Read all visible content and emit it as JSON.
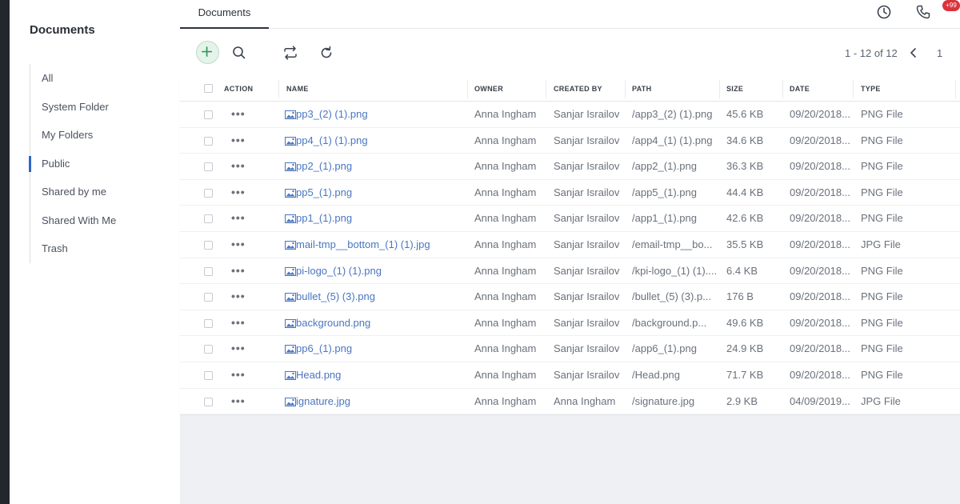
{
  "sidebar": {
    "title": "Documents",
    "items": [
      {
        "label": "All"
      },
      {
        "label": "System Folder"
      },
      {
        "label": "My Folders"
      },
      {
        "label": "Public",
        "active": true
      },
      {
        "label": "Shared by me"
      },
      {
        "label": "Shared With Me"
      },
      {
        "label": "Trash"
      }
    ]
  },
  "header": {
    "tab": "Documents",
    "badge": "+99",
    "icons": [
      "clock-icon",
      "phone-icon"
    ]
  },
  "toolbar": {
    "icons": [
      "plus-icon",
      "search-icon",
      "transfer-icon",
      "refresh-icon"
    ],
    "pagination": {
      "range": "1 - 12 of 12",
      "page": "1"
    }
  },
  "table": {
    "columns": [
      "ACTION",
      "NAME",
      "OWNER",
      "CREATED BY",
      "PATH",
      "SIZE",
      "DATE",
      "TYPE"
    ],
    "rows": [
      {
        "name": "pp3_(2) (1).png",
        "owner": "Anna Ingham",
        "created_by": "Sanjar Israilov",
        "path": "/app3_(2) (1).png",
        "size": "45.6 KB",
        "date": "09/20/2018...",
        "type": "PNG File"
      },
      {
        "name": "pp4_(1) (1).png",
        "owner": "Anna Ingham",
        "created_by": "Sanjar Israilov",
        "path": "/app4_(1) (1).png",
        "size": "34.6 KB",
        "date": "09/20/2018...",
        "type": "PNG File"
      },
      {
        "name": "pp2_(1).png",
        "owner": "Anna Ingham",
        "created_by": "Sanjar Israilov",
        "path": "/app2_(1).png",
        "size": "36.3 KB",
        "date": "09/20/2018...",
        "type": "PNG File"
      },
      {
        "name": "pp5_(1).png",
        "owner": "Anna Ingham",
        "created_by": "Sanjar Israilov",
        "path": "/app5_(1).png",
        "size": "44.4 KB",
        "date": "09/20/2018...",
        "type": "PNG File"
      },
      {
        "name": "pp1_(1).png",
        "owner": "Anna Ingham",
        "created_by": "Sanjar Israilov",
        "path": "/app1_(1).png",
        "size": "42.6 KB",
        "date": "09/20/2018...",
        "type": "PNG File"
      },
      {
        "name": "mail-tmp__bottom_(1) (1).jpg",
        "owner": "Anna Ingham",
        "created_by": "Sanjar Israilov",
        "path": "/email-tmp__bo...",
        "size": "35.5 KB",
        "date": "09/20/2018...",
        "type": "JPG File"
      },
      {
        "name": "pi-logo_(1) (1).png",
        "owner": "Anna Ingham",
        "created_by": "Sanjar Israilov",
        "path": "/kpi-logo_(1) (1)....",
        "size": "6.4 KB",
        "date": "09/20/2018...",
        "type": "PNG File"
      },
      {
        "name": "bullet_(5) (3).png",
        "owner": "Anna Ingham",
        "created_by": "Sanjar Israilov",
        "path": "/bullet_(5) (3).p...",
        "size": "176 B",
        "date": "09/20/2018...",
        "type": "PNG File"
      },
      {
        "name": "background.png",
        "owner": "Anna Ingham",
        "created_by": "Sanjar Israilov",
        "path": "/background.p...",
        "size": "49.6 KB",
        "date": "09/20/2018...",
        "type": "PNG File"
      },
      {
        "name": "pp6_(1).png",
        "owner": "Anna Ingham",
        "created_by": "Sanjar Israilov",
        "path": "/app6_(1).png",
        "size": "24.9 KB",
        "date": "09/20/2018...",
        "type": "PNG File"
      },
      {
        "name": "Head.png",
        "owner": "Anna Ingham",
        "created_by": "Sanjar Israilov",
        "path": "/Head.png",
        "size": "71.7 KB",
        "date": "09/20/2018...",
        "type": "PNG File"
      },
      {
        "name": "ignature.jpg",
        "owner": "Anna Ingham",
        "created_by": "Anna Ingham",
        "path": "/signature.jpg",
        "size": "2.9 KB",
        "date": "04/09/2019...",
        "type": "JPG File"
      }
    ]
  }
}
